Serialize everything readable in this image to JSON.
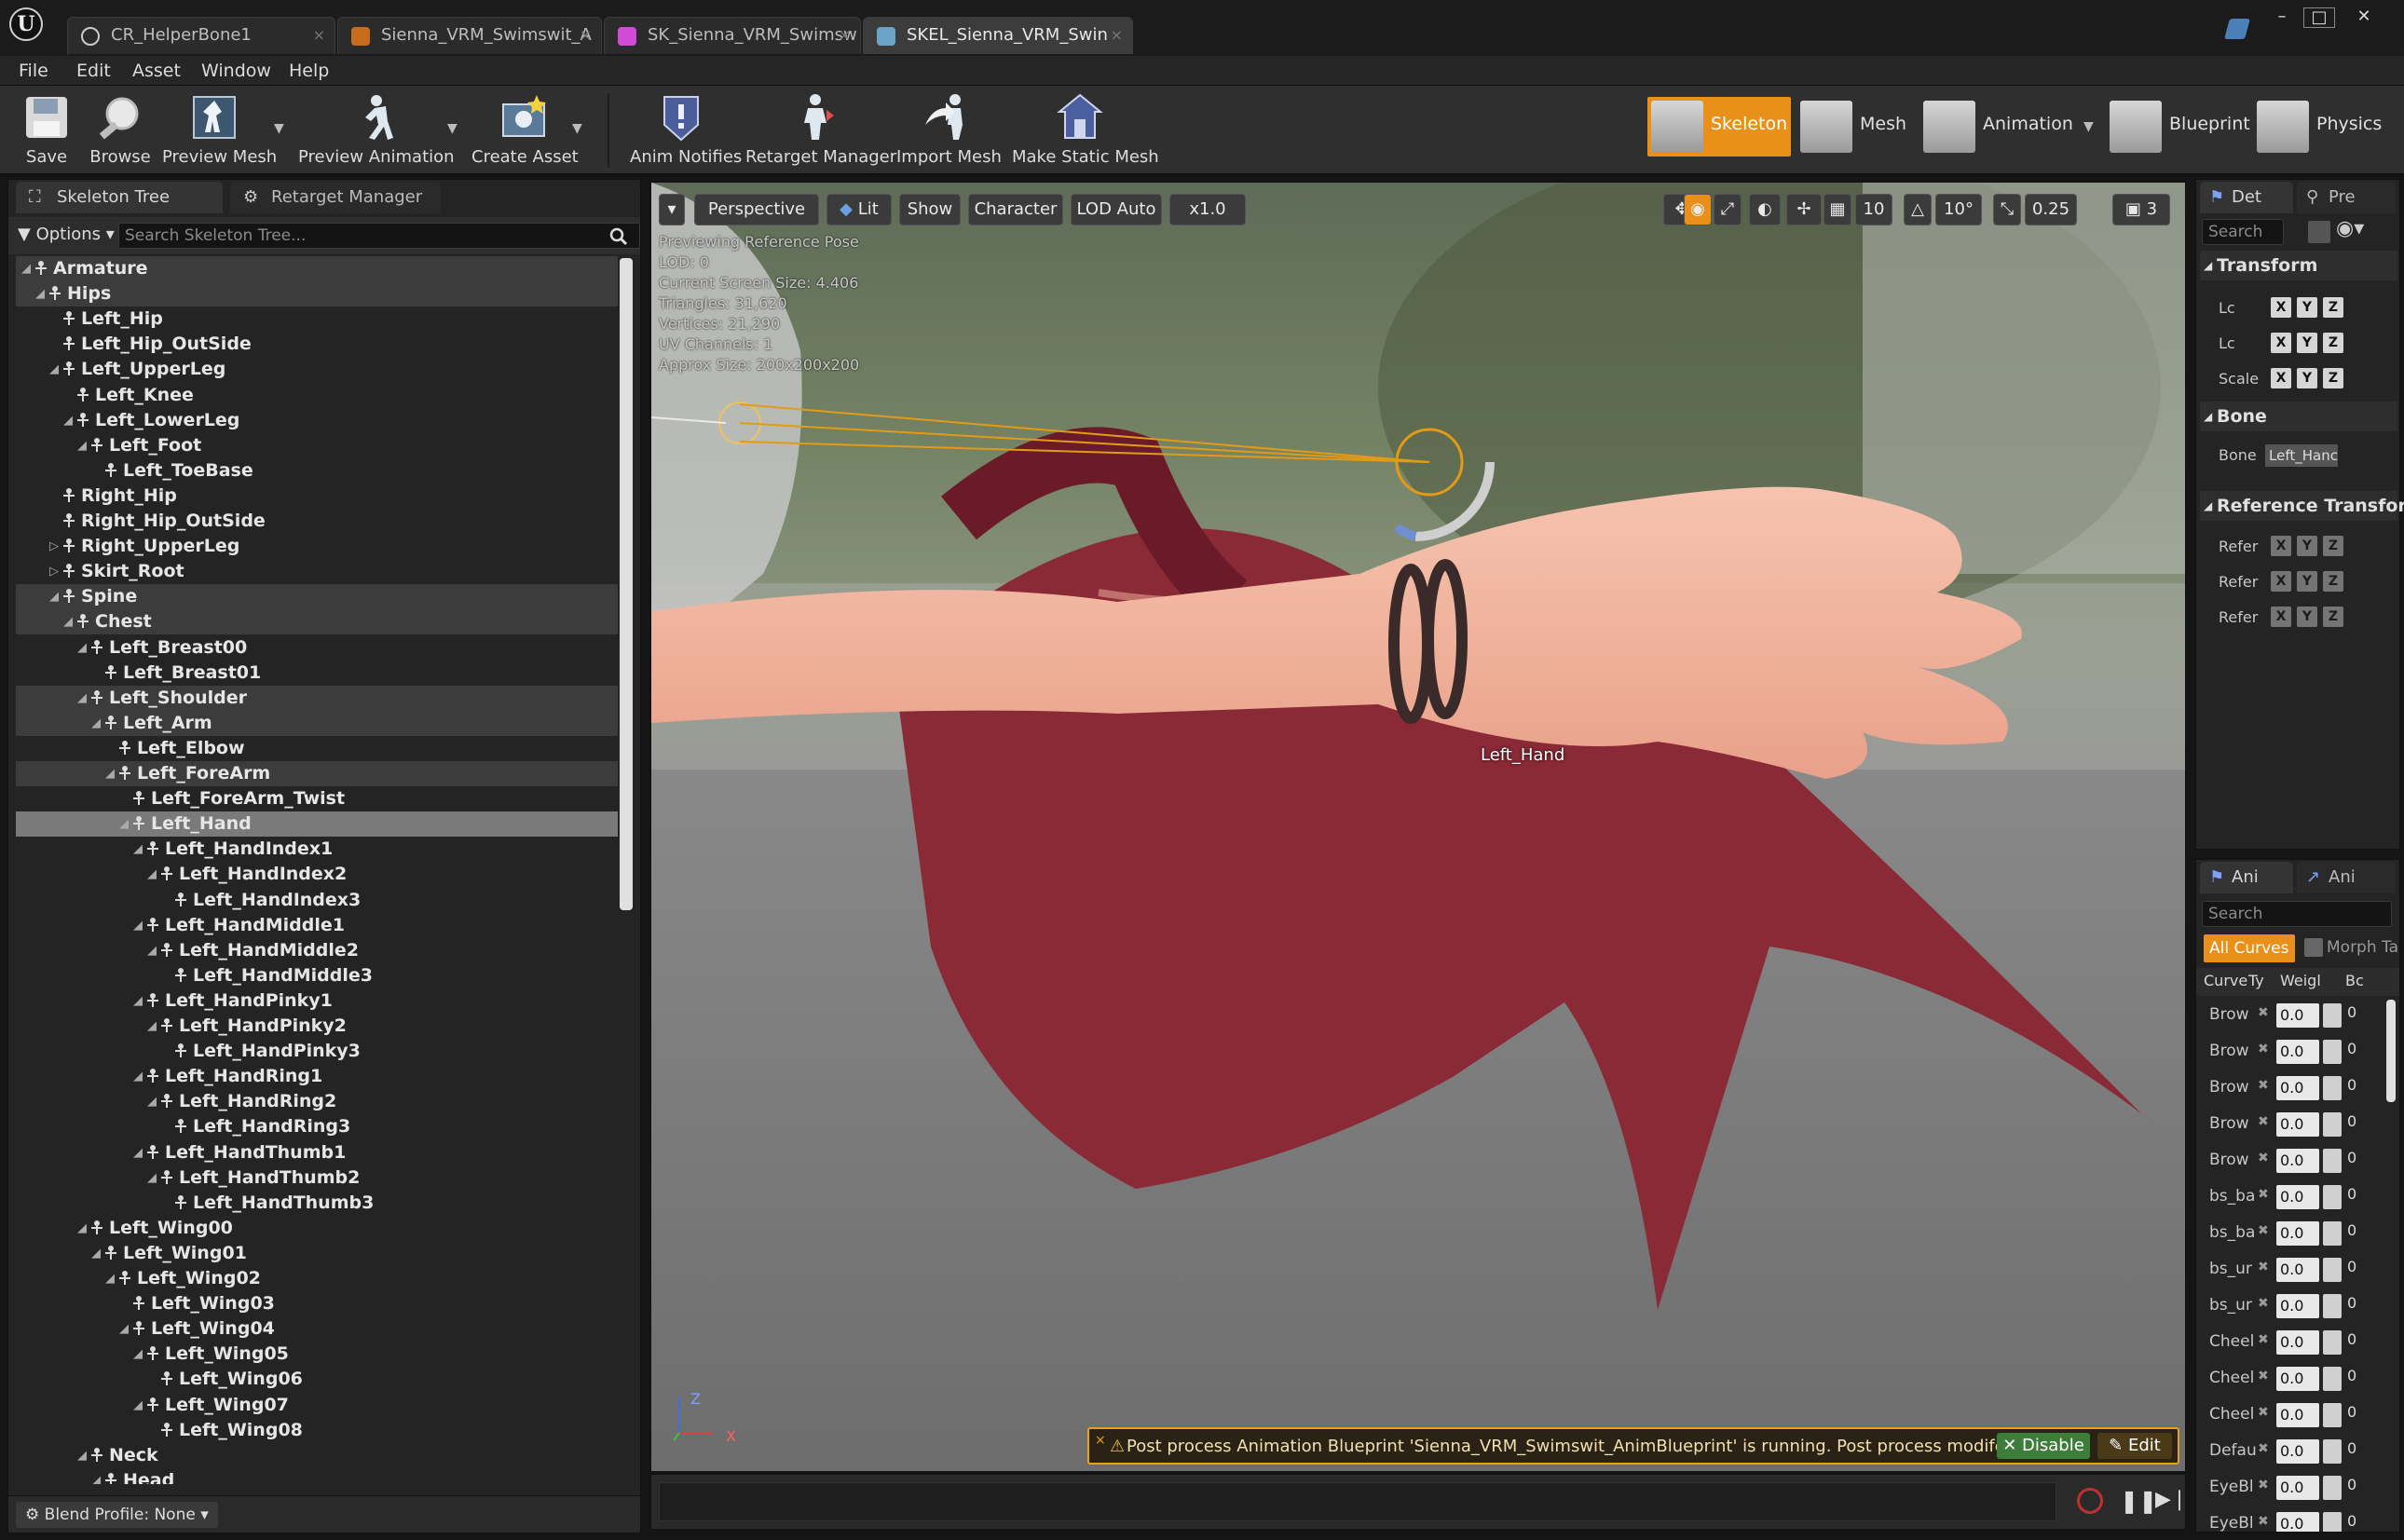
{
  "titlebar": {
    "tabs": [
      {
        "label": "CR_HelperBone1",
        "icon": "circle-icon"
      },
      {
        "label": "Sienna_VRM_Swimswit_A",
        "icon": "anim-icon"
      },
      {
        "label": "SK_Sienna_VRM_Swimsw",
        "icon": "skeletal-mesh-icon"
      },
      {
        "label": "SKEL_Sienna_VRM_Swin",
        "icon": "skeleton-icon"
      }
    ],
    "close_glyph": "×",
    "window_controls": [
      "–",
      "□",
      "✕"
    ]
  },
  "menu": [
    "File",
    "Edit",
    "Asset",
    "Window",
    "Help"
  ],
  "toolbar": {
    "save": "Save",
    "browse": "Browse",
    "preview_mesh": "Preview Mesh",
    "preview_animation": "Preview Animation",
    "create_asset": "Create Asset",
    "anim_notifies": "Anim Notifies",
    "retarget_manager": "Retarget Manager",
    "import_mesh": "Import Mesh",
    "make_static_mesh": "Make Static Mesh",
    "modes": [
      "Skeleton",
      "Mesh",
      "Animation",
      "Blueprint",
      "Physics"
    ],
    "active_mode": "Skeleton",
    "accent_color": "#e8901a"
  },
  "left_panel": {
    "tabs": [
      "Skeleton Tree",
      "Retarget Manager"
    ],
    "options": "Options",
    "search_placeholder": "Search Skeleton Tree...",
    "blend_profile": "Blend Profile: None",
    "tree": [
      {
        "name": "Armature",
        "depth": 0,
        "expanded": true,
        "hl": true
      },
      {
        "name": "Hips",
        "depth": 1,
        "expanded": true,
        "hl": true
      },
      {
        "name": "Left_Hip",
        "depth": 2
      },
      {
        "name": "Left_Hip_OutSide",
        "depth": 2
      },
      {
        "name": "Left_UpperLeg",
        "depth": 2,
        "expanded": true
      },
      {
        "name": "Left_Knee",
        "depth": 3
      },
      {
        "name": "Left_LowerLeg",
        "depth": 3,
        "expanded": true
      },
      {
        "name": "Left_Foot",
        "depth": 4,
        "expanded": true
      },
      {
        "name": "Left_ToeBase",
        "depth": 5
      },
      {
        "name": "Right_Hip",
        "depth": 2
      },
      {
        "name": "Right_Hip_OutSide",
        "depth": 2
      },
      {
        "name": "Right_UpperLeg",
        "depth": 2,
        "expanded": false
      },
      {
        "name": "Skirt_Root",
        "depth": 2,
        "expanded": false
      },
      {
        "name": "Spine",
        "depth": 2,
        "expanded": true,
        "hl": true
      },
      {
        "name": "Chest",
        "depth": 3,
        "expanded": true,
        "hl": true
      },
      {
        "name": "Left_Breast00",
        "depth": 4,
        "expanded": true
      },
      {
        "name": "Left_Breast01",
        "depth": 5
      },
      {
        "name": "Left_Shoulder",
        "depth": 4,
        "expanded": true,
        "hl": true
      },
      {
        "name": "Left_Arm",
        "depth": 5,
        "expanded": true,
        "hl": true
      },
      {
        "name": "Left_Elbow",
        "depth": 6
      },
      {
        "name": "Left_ForeArm",
        "depth": 6,
        "expanded": true,
        "hl": true
      },
      {
        "name": "Left_ForeArm_Twist",
        "depth": 7
      },
      {
        "name": "Left_Hand",
        "depth": 7,
        "expanded": true,
        "sel": true
      },
      {
        "name": "Left_HandIndex1",
        "depth": 8,
        "expanded": true
      },
      {
        "name": "Left_HandIndex2",
        "depth": 9,
        "expanded": true
      },
      {
        "name": "Left_HandIndex3",
        "depth": 10
      },
      {
        "name": "Left_HandMiddle1",
        "depth": 8,
        "expanded": true
      },
      {
        "name": "Left_HandMiddle2",
        "depth": 9,
        "expanded": true
      },
      {
        "name": "Left_HandMiddle3",
        "depth": 10
      },
      {
        "name": "Left_HandPinky1",
        "depth": 8,
        "expanded": true
      },
      {
        "name": "Left_HandPinky2",
        "depth": 9,
        "expanded": true
      },
      {
        "name": "Left_HandPinky3",
        "depth": 10
      },
      {
        "name": "Left_HandRing1",
        "depth": 8,
        "expanded": true
      },
      {
        "name": "Left_HandRing2",
        "depth": 9,
        "expanded": true
      },
      {
        "name": "Left_HandRing3",
        "depth": 10
      },
      {
        "name": "Left_HandThumb1",
        "depth": 8,
        "expanded": true
      },
      {
        "name": "Left_HandThumb2",
        "depth": 9,
        "expanded": true
      },
      {
        "name": "Left_HandThumb3",
        "depth": 10
      },
      {
        "name": "Left_Wing00",
        "depth": 4,
        "expanded": true
      },
      {
        "name": "Left_Wing01",
        "depth": 5,
        "expanded": true
      },
      {
        "name": "Left_Wing02",
        "depth": 6,
        "expanded": true
      },
      {
        "name": "Left_Wing03",
        "depth": 7
      },
      {
        "name": "Left_Wing04",
        "depth": 7,
        "expanded": true
      },
      {
        "name": "Left_Wing05",
        "depth": 8,
        "expanded": true
      },
      {
        "name": "Left_Wing06",
        "depth": 9
      },
      {
        "name": "Left_Wing07",
        "depth": 8,
        "expanded": true
      },
      {
        "name": "Left_Wing08",
        "depth": 9
      },
      {
        "name": "Neck",
        "depth": 4,
        "expanded": true
      },
      {
        "name": "Head",
        "depth": 5,
        "expanded": true
      }
    ]
  },
  "viewport": {
    "perspective": "Perspective",
    "lit": "Lit",
    "show": "Show",
    "character": "Character",
    "lod": "LOD Auto",
    "speed": "x1.0",
    "grid_value": "10",
    "angle_value": "10°",
    "scale_value": "0.25",
    "camera_speed": "3",
    "info": [
      "Previewing Reference Pose",
      "LOD: 0",
      "Current Screen Size: 4.406",
      "Triangles: 31,620",
      "Vertices: 21,290",
      "UV Channels: 1",
      "Approx Size: 200x200x200"
    ],
    "bone_label": "Left_Hand",
    "axis_z": "Z",
    "axis_x": "X",
    "warning": "Post process Animation Blueprint 'Sienna_VRM_Swimswit_AnimBlueprint' is running. Post process modifes curves.",
    "disable": "Disable",
    "edit": "Edit"
  },
  "details": {
    "tabs": [
      "Det",
      "Pre"
    ],
    "search": "Search",
    "transform": "Transform",
    "transform_rows": [
      "Lc",
      "Lc",
      "Scale"
    ],
    "bone_section": "Bone",
    "bone_label": "Bone",
    "bone_value": "Left_Hanc",
    "reference_transform": "Reference Transform",
    "ref_rows": [
      "Refer",
      "Refer",
      "Refer"
    ],
    "xyz": [
      "X",
      "Y",
      "Z"
    ]
  },
  "curves": {
    "tabs": [
      "Ani",
      "Ani"
    ],
    "search": "Search",
    "all_curves": "All Curves",
    "morph": "Morph Ta",
    "headers": [
      "Curve",
      "Ty",
      "Weigl",
      "Bc"
    ],
    "rows": [
      {
        "name": "Brow",
        "weight": "0.0",
        "bone": "0"
      },
      {
        "name": "Brow",
        "weight": "0.0",
        "bone": "0"
      },
      {
        "name": "Brow",
        "weight": "0.0",
        "bone": "0"
      },
      {
        "name": "Brow",
        "weight": "0.0",
        "bone": "0"
      },
      {
        "name": "Brow",
        "weight": "0.0",
        "bone": "0"
      },
      {
        "name": "bs_ba",
        "weight": "0.0",
        "bone": "0"
      },
      {
        "name": "bs_ba",
        "weight": "0.0",
        "bone": "0"
      },
      {
        "name": "bs_ur",
        "weight": "0.0",
        "bone": "0"
      },
      {
        "name": "bs_ur",
        "weight": "0.0",
        "bone": "0"
      },
      {
        "name": "Cheel",
        "weight": "0.0",
        "bone": "0"
      },
      {
        "name": "Cheel",
        "weight": "0.0",
        "bone": "0"
      },
      {
        "name": "Cheel",
        "weight": "0.0",
        "bone": "0"
      },
      {
        "name": "Defau",
        "weight": "0.0",
        "bone": "0"
      },
      {
        "name": "EyeBl",
        "weight": "0.0",
        "bone": "0"
      },
      {
        "name": "EyeBl",
        "weight": "0.0",
        "bone": "0"
      }
    ]
  }
}
